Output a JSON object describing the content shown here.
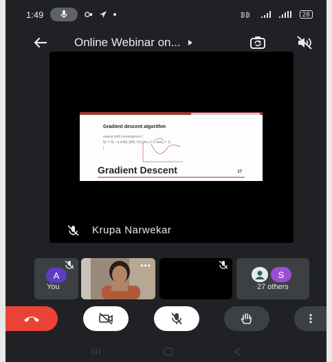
{
  "status": {
    "time": "1:49",
    "battery": "28"
  },
  "header": {
    "title": "Online Webinar on..."
  },
  "presentation": {
    "slide_title": "Gradient descent algorithm",
    "slide_formula_line1": "repeat until convergence {",
    "slide_formula_line2": "θj := θj − α ∂/∂θj J(θ0, θ1)     (for j = 0 and j = 1)",
    "slide_formula_line3": "}",
    "slide_big_text": "Gradient Descent",
    "slide_number": "17"
  },
  "main_tile": {
    "name": "Krupa Narwekar"
  },
  "participants": {
    "you": {
      "initial": "A",
      "label": "You",
      "color": "#5f3dc4"
    },
    "others": {
      "initial": "S",
      "label": "27 others",
      "color": "#9c4fd6"
    }
  },
  "colors": {
    "end_call": "#ea4335",
    "background": "#202124",
    "tile": "#3c4043"
  }
}
